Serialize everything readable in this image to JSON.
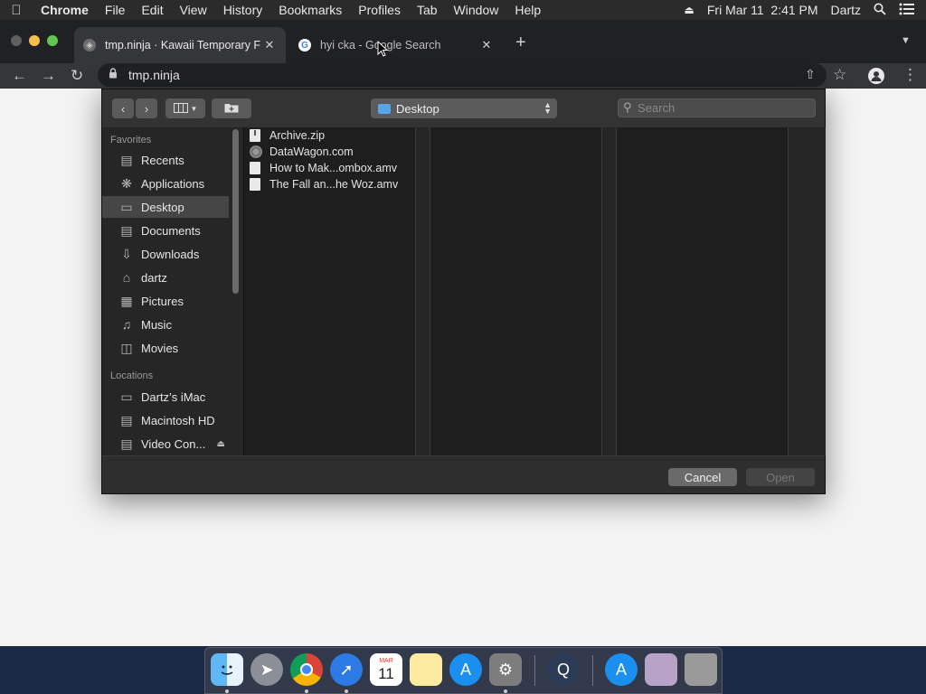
{
  "menubar": {
    "apple_icon": "apple-logo",
    "items": [
      "Chrome",
      "File",
      "Edit",
      "View",
      "History",
      "Bookmarks",
      "Profiles",
      "Tab",
      "Window",
      "Help"
    ],
    "datetime": "Fri Mar 11  2:41 PM",
    "user": "Dartz"
  },
  "chrome": {
    "tabs": [
      {
        "title": "tmp.ninja · Kawaii Temporary F",
        "active": true
      },
      {
        "title": "hyi cka - Google Search",
        "active": false
      }
    ],
    "url": "tmp.ninja"
  },
  "dialog": {
    "location": "Desktop",
    "search_placeholder": "Search",
    "sidebar": {
      "favorites_heading": "Favorites",
      "favorites": [
        {
          "label": "Recents",
          "icon": "clock-icon"
        },
        {
          "label": "Applications",
          "icon": "applications-icon"
        },
        {
          "label": "Desktop",
          "icon": "desktop-icon",
          "selected": true
        },
        {
          "label": "Documents",
          "icon": "document-icon"
        },
        {
          "label": "Downloads",
          "icon": "download-icon"
        },
        {
          "label": "dartz",
          "icon": "home-icon"
        },
        {
          "label": "Pictures",
          "icon": "pictures-icon"
        },
        {
          "label": "Music",
          "icon": "music-icon"
        },
        {
          "label": "Movies",
          "icon": "movies-icon"
        }
      ],
      "locations_heading": "Locations",
      "locations": [
        {
          "label": "Dartz’s iMac",
          "icon": "computer-icon"
        },
        {
          "label": "Macintosh HD",
          "icon": "disk-icon"
        },
        {
          "label": "Video Con...",
          "icon": "disk-icon",
          "ejectable": true
        }
      ]
    },
    "files": [
      {
        "name": "Archive.zip",
        "icon": "zip-file-icon"
      },
      {
        "name": "DataWagon.com",
        "icon": "web-location-icon"
      },
      {
        "name": "How to Mak...ombox.amv",
        "icon": "file-icon"
      },
      {
        "name": "The Fall an...he Woz.amv",
        "icon": "file-icon"
      }
    ],
    "cancel_label": "Cancel",
    "open_label": "Open"
  },
  "dock": {
    "apps": [
      "finder",
      "launchpad",
      "chrome",
      "safari",
      "calendar",
      "notes",
      "app-store",
      "system-preferences",
      "quicktime",
      "applications-folder",
      "documents-stack",
      "trash"
    ],
    "calendar_month": "MAR",
    "calendar_day": "11"
  },
  "colors": {
    "menubar_bg": "#2b2b2b",
    "tabstrip_bg": "#202124",
    "toolbar_bg": "#35363a",
    "dialog_bg": "#2d2d2d",
    "selection": "#464646",
    "traffic_close": "#5f5f5f",
    "traffic_min": "#f5bf4f",
    "traffic_max": "#62c554",
    "folder_blue": "#5aa5e8"
  }
}
